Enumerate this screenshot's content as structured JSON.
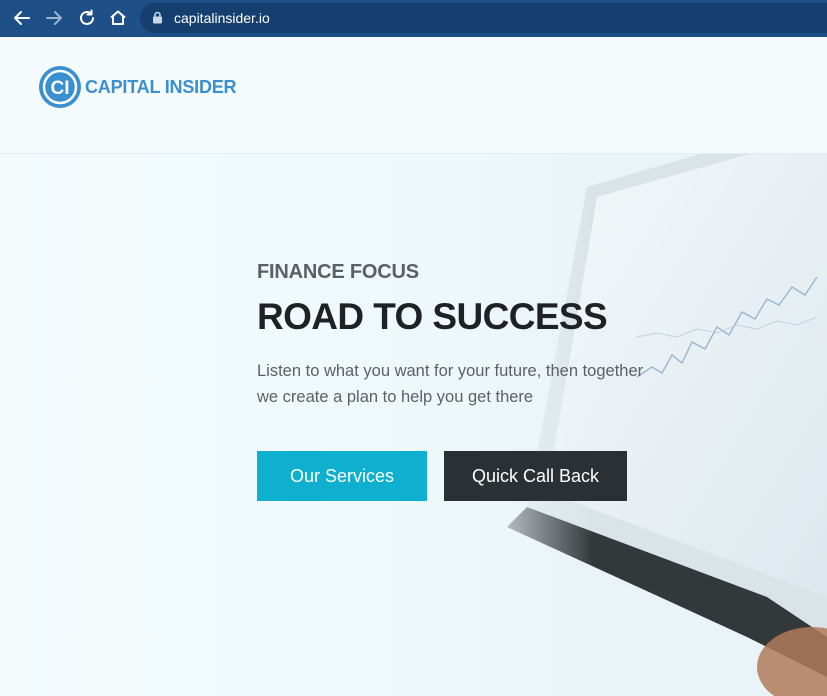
{
  "browser": {
    "url": "capitalinsider.io"
  },
  "header": {
    "logo_mark": "CI",
    "logo_text": "CAPITAL INSIDER"
  },
  "hero": {
    "eyebrow": "FINANCE FOCUS",
    "headline": "ROAD TO SUCCESS",
    "subtitle_line1": "Listen to what you want for your future, then together",
    "subtitle_line2": "we create a plan to help you get there",
    "primary_button": "Our Services",
    "secondary_button": "Quick Call Back"
  },
  "colors": {
    "chrome": "#1e4f86",
    "brand": "#3a8fd0",
    "primary_button": "#0fb0cf",
    "secondary_button": "#2a3034"
  },
  "icons": [
    "back-icon",
    "forward-icon",
    "reload-icon",
    "home-icon",
    "lock-icon"
  ]
}
